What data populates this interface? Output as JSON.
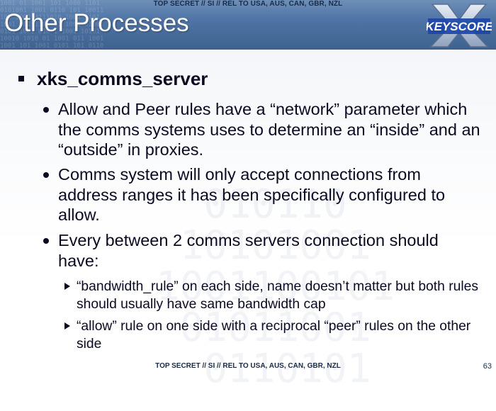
{
  "classification": "TOP SECRET // SI // REL TO USA, AUS, CAN, GBR, NZL",
  "title": "Other Processes",
  "logo": {
    "text": "KEYSCORE",
    "icon": "x-logo"
  },
  "heading": "xks_comms_server",
  "bullets": [
    {
      "text": "Allow and Peer rules have a “network” parameter which the comms systems uses to determine an “inside” and an “outside” in proxies."
    },
    {
      "text": "Comms system will only accept connections from address ranges it has been specifically configured to allow."
    },
    {
      "text": "Every between 2 comms servers connection should have:"
    }
  ],
  "subbullets": [
    {
      "text": "“bandwidth_rule” on each side, name doesn’t matter but both rules should usually have same bandwidth cap"
    },
    {
      "text": "“allow” rule on one side with a reciprocal “peer” rules on the other side"
    }
  ],
  "page_number": "63",
  "colors": {
    "banner": "#4f74a5",
    "text": "#0a0a23",
    "classification": "#1c2b45"
  }
}
